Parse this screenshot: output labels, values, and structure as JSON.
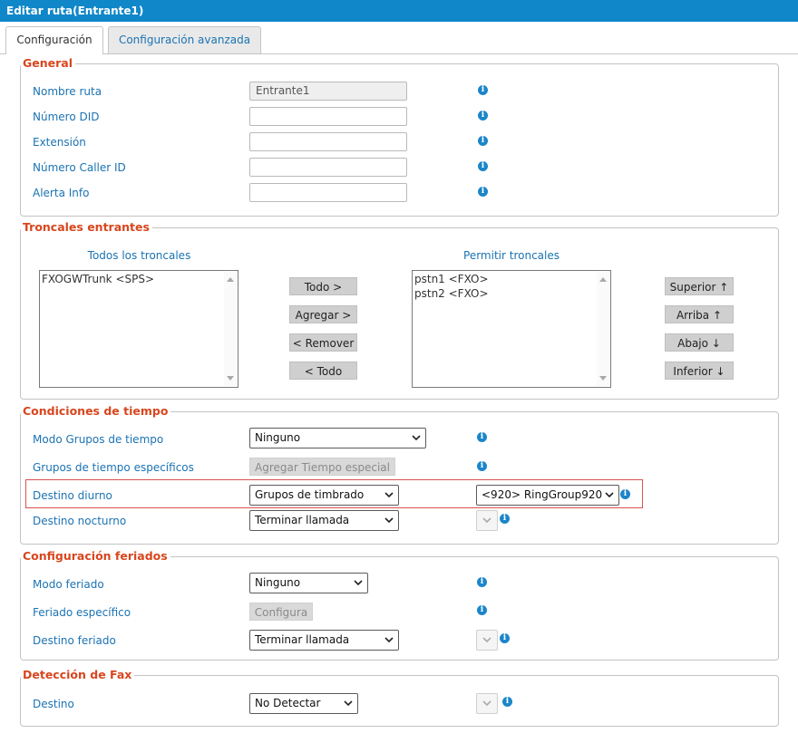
{
  "window": {
    "title": "Editar ruta(Entrante1)"
  },
  "tabs": [
    {
      "label": "Configuración",
      "active": true
    },
    {
      "label": "Configuración avanzada",
      "active": false
    }
  ],
  "general": {
    "legend": "General",
    "route_name": {
      "label": "Nombre ruta",
      "value": "Entrante1"
    },
    "did_number": {
      "label": "Número DID",
      "value": ""
    },
    "extension": {
      "label": "Extensión",
      "value": ""
    },
    "caller_id": {
      "label": "Número Caller ID",
      "value": ""
    },
    "alert_info": {
      "label": "Alerta Info",
      "value": ""
    }
  },
  "trunks": {
    "legend": "Troncales entrantes",
    "all_header": "Todos los troncales",
    "allowed_header": "Permitir troncales",
    "all_items": [
      "FXOGWTrunk <SPS>"
    ],
    "allowed_items": [
      "pstn1 <FXO>",
      "pstn2 <FXO>"
    ],
    "buttons": {
      "all_right": "Todo >",
      "add": "Agregar >",
      "remove": "< Remover",
      "all_left": "< Todo",
      "top": "Superior ↑",
      "up": "Arriba ↑",
      "down": "Abajo ↓",
      "bottom": "Inferior ↓"
    }
  },
  "time": {
    "legend": "Condiciones de tiempo",
    "mode": {
      "label": "Modo Grupos de tiempo",
      "value": "Ninguno"
    },
    "specific": {
      "label": "Grupos de tiempo específicos",
      "button": "Agregar Tiempo especial"
    },
    "day_dest": {
      "label": "Destino diurno",
      "value": "Grupos de timbrado",
      "target": "<920> RingGroup920"
    },
    "night_dest": {
      "label": "Destino nocturno",
      "value": "Terminar llamada"
    }
  },
  "holiday": {
    "legend": "Configuración feriados",
    "mode": {
      "label": "Modo feriado",
      "value": "Ninguno"
    },
    "specific": {
      "label": "Feriado específico",
      "button": "Configura"
    },
    "dest": {
      "label": "Destino feriado",
      "value": "Terminar llamada"
    }
  },
  "fax": {
    "legend": "Detección de Fax",
    "dest": {
      "label": "Destino",
      "value": "No Detectar"
    }
  },
  "colors": {
    "accent": "#0f87c9",
    "legend": "#d8461e",
    "label": "#1b73b3",
    "highlight": "#d9534f"
  },
  "icons": {
    "info": "info-icon",
    "chevron": "chevron-down-icon"
  }
}
